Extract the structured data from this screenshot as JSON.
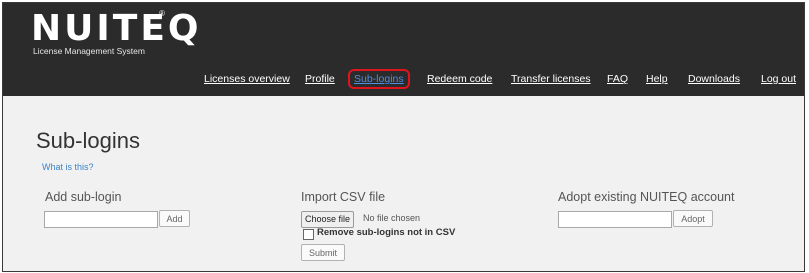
{
  "header": {
    "logo_text": "NUITEQ",
    "logo_mark": "®",
    "tagline": "License Management System"
  },
  "nav": {
    "items": [
      {
        "label": "Licenses overview"
      },
      {
        "label": "Profile"
      },
      {
        "label": "Sub-logins",
        "active": true
      },
      {
        "label": "Redeem code"
      },
      {
        "label": "Transfer licenses"
      },
      {
        "label": "FAQ"
      },
      {
        "label": "Help"
      },
      {
        "label": "Downloads"
      },
      {
        "label": "Log out"
      }
    ]
  },
  "page": {
    "title": "Sub-logins",
    "help_link": "What is this?"
  },
  "add_sublogin": {
    "title": "Add sub-login",
    "input_value": "",
    "button_label": "Add"
  },
  "import_csv": {
    "title": "Import CSV file",
    "choose_file_label": "Choose file",
    "file_status": "No file chosen",
    "checkbox_label": "Remove sub-logins not in CSV",
    "checkbox_checked": false,
    "submit_label": "Submit"
  },
  "adopt_account": {
    "title": "Adopt existing NUITEQ account",
    "input_value": "",
    "button_label": "Adopt"
  },
  "colors": {
    "header_bg": "#2b2b2b",
    "content_bg": "#f1f1f1",
    "active_nav": "#4f8de0",
    "active_highlight": "#e0141e",
    "link": "#3b83c9"
  }
}
